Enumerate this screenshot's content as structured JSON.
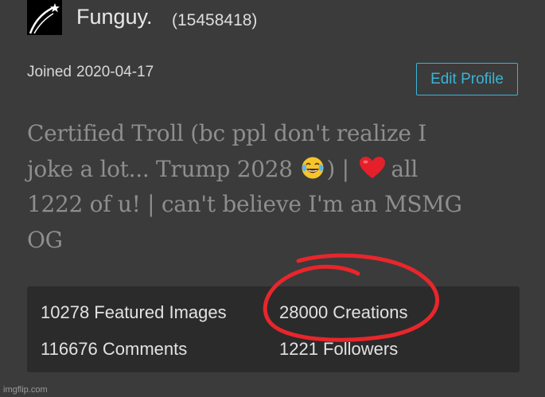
{
  "profile": {
    "username": "Funguy.",
    "user_id": "(15458418)",
    "joined_label": "Joined",
    "joined_date": "2020-04-17",
    "edit_button_label": "Edit Profile",
    "avatar_icon": "shooting-star-icon"
  },
  "bio": {
    "line1": "Certified Troll (bc ppl don't realize I",
    "line2_before": "joke a lot... Trump 2028",
    "line2_mid": ") |",
    "line2_after": "all",
    "line3": "1222 of u! | can't believe I'm an MSMG",
    "line4": "OG",
    "emoji_1": "laughing-tears-emoji",
    "emoji_2": "red-heart-emoji"
  },
  "stats": {
    "featured_images": "10278 Featured Images",
    "creations": "28000 Creations",
    "comments": "116676 Comments",
    "followers": "1221 Followers"
  },
  "annotation": {
    "type": "hand-drawn-red-circle",
    "target": "creations",
    "color": "#e8262b"
  },
  "watermark": "imgflip.com",
  "colors": {
    "background": "#3b3b3b",
    "stats_box": "#2b2b2b",
    "accent": "#3ab4d8",
    "bio_text": "#8e8e8e"
  }
}
